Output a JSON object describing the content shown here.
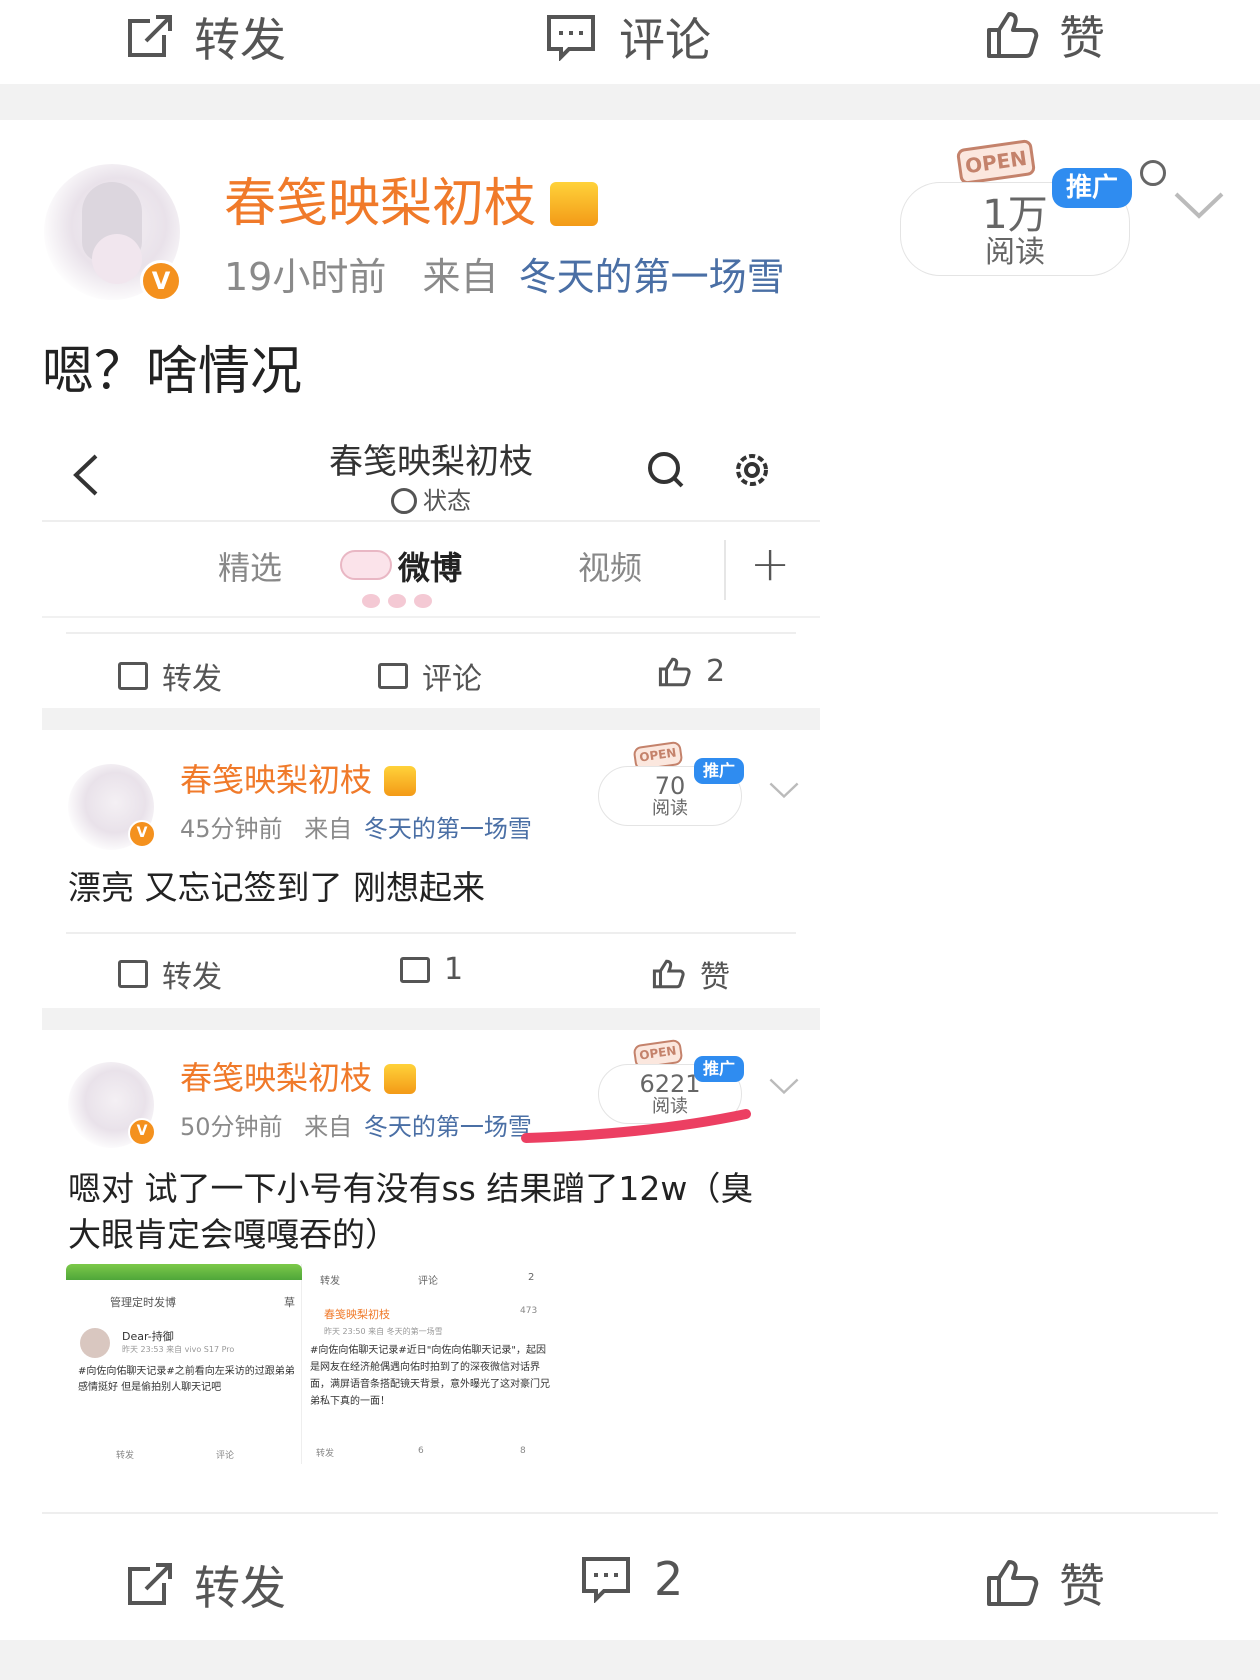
{
  "top_actions": {
    "repost": "转发",
    "comment": "评论",
    "like": "赞"
  },
  "post": {
    "author": "春笺映梨初枝",
    "time": "19小时前",
    "from_label": "来自",
    "source": "冬天的第一场雪",
    "read_count": "1万",
    "read_label": "阅读",
    "promo_label": "推广",
    "open_label": "OPEN",
    "text": "嗯？啥情况",
    "v_badge": "V"
  },
  "screenshot": {
    "header_title": "春笺映梨初枝",
    "header_status": "状态",
    "tabs": [
      "精选",
      "微博",
      "视频"
    ],
    "plus": "+",
    "bar1": {
      "repost": "转发",
      "comment": "评论",
      "like": "2"
    },
    "card1": {
      "author": "春笺映梨初枝",
      "time": "45分钟前",
      "from_label": "来自",
      "source": "冬天的第一场雪",
      "read_count": "70",
      "read_label": "阅读",
      "promo_label": "推广",
      "open_label": "OPEN",
      "text": "漂亮 又忘记签到了 刚想起来",
      "repost": "转发",
      "comment": "1",
      "like": "赞"
    },
    "card2": {
      "author": "春笺映梨初枝",
      "time": "50分钟前",
      "from_label": "来自",
      "source": "冬天的第一场雪",
      "read_count": "6221",
      "read_label": "阅读",
      "promo_label": "推广",
      "open_label": "OPEN",
      "text": "嗯对 试了一下小号有没有ss 结果蹭了12w（臭大眼肯定会嘎嘎吞的）"
    },
    "thumb": {
      "left_title": "管理定时发博",
      "left_right": "草",
      "left_user": "Dear-持御",
      "left_meta": "昨天 23:53  来自 vivo S17 Pro",
      "left_text": "#向佐向佑聊天记录#之前看向左采访的过跟弟弟感情挺好 但是偷拍别人聊天记吧",
      "left_repost": "转发",
      "left_comment": "评论",
      "right_top_repost": "转发",
      "right_top_comment": "评论",
      "right_top_like": "2",
      "right_author": "春笺映梨初枝",
      "right_meta": "昨天 23:50  来自 冬天的第一场雪",
      "right_read": "473",
      "right_text": "#向佐向佑聊天记录#近日\"向佐向佑聊天记录\"，起因是网友在经济舱偶遇向佑时拍到了的深夜微信对话界面，满屏语音条搭配镜天背景，意外曝光了这对豪门兄弟私下真的一面！",
      "right_repost": "转发",
      "right_comment": "6",
      "right_like": "8"
    }
  },
  "bottom_actions": {
    "repost": "转发",
    "comment": "2",
    "like": "赞"
  }
}
